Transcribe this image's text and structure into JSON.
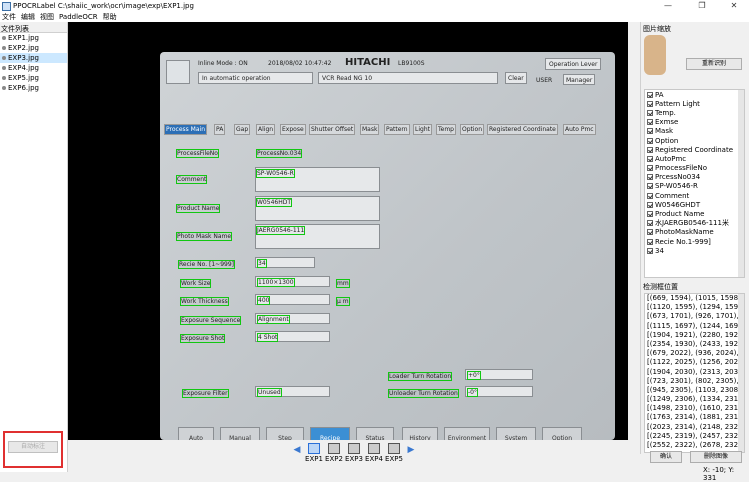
{
  "window": {
    "title": "PPOCRLabel C:\\shaiic_work\\ocr\\image\\exp\\EXP1.jpg",
    "min": "—",
    "max": "❐",
    "close": "✕"
  },
  "menu": [
    "文件",
    "编辑",
    "视图",
    "PaddleOCR",
    "帮助"
  ],
  "file_list": {
    "header": "文件列表",
    "items": [
      "EXP1.jpg",
      "EXP2.jpg",
      "EXP3.jpg",
      "EXP4.jpg",
      "EXP5.jpg",
      "EXP6.jpg"
    ],
    "selected": 2
  },
  "auto_label_button": "自动标注",
  "screen": {
    "inline_mode": "Inline Mode : ON",
    "datetime": "2018/08/02  10:47:42",
    "brand": "HITACHI",
    "model": "LB9100S",
    "auto_op": "In automatic operation",
    "vcr": "VCR Read NG 10",
    "operation_lever": "Operation Lever",
    "clear": "Clear",
    "user": "USER",
    "manager": "Manager",
    "tabs": [
      "Process Main",
      "PA",
      "Gap",
      "Align",
      "Expose",
      "Shutter Offset",
      "Mask",
      "Pattern",
      "Light",
      "Temp",
      "Option",
      "Registered Coordinate",
      "Auto Pmc"
    ],
    "fields": {
      "process_file_no_label": "ProcessFileNo",
      "process_file_no_value": "ProcessNo.034",
      "comment_label": "Comment",
      "comment_value": "SP-W0546-R",
      "product_name_label": "Product Name",
      "product_name_value": "W0546HDT",
      "photo_mask_label": "Photo Mask Name",
      "photo_mask_value": "JAERG0546-111",
      "recipe_no_label": "Recie No. [1~999]",
      "recipe_no_value": "34",
      "work_size_label": "Work Size",
      "work_size_value": "1100×1300  ",
      "work_size_unit": "mm",
      "work_thickness_label": "Work Thickness",
      "work_thickness_value": "400",
      "work_thickness_unit": "μ m",
      "exposure_sequence_label": "Exposure Sequence",
      "exposure_sequence_value": "Alignment",
      "exposure_shot_label": "Exposure Shot",
      "exposure_shot_value": "4 Shot",
      "exposure_filter_label": "Exposure Filter",
      "exposure_filter_value": "Unused",
      "loader_turn_label": "Loader Turn Rotation",
      "loader_turn_value": "+0°",
      "unloader_turn_label": "Unloader Turn Rotation",
      "unloader_turn_value": "-0°"
    },
    "bottom_buttons": [
      "Auto",
      "Manual",
      "Step",
      "Recipe",
      "Status",
      "History",
      "Environment",
      "System",
      "Option"
    ]
  },
  "right_panel": {
    "zoom_header": "图片缩放",
    "relabel": "重新识别",
    "labels": [
      "PA",
      "Pattern Light",
      "Temp.",
      "Exmse",
      "Mask",
      "Option",
      "Registered Coordinate",
      "AutoPmc",
      "PmocessFileNo",
      "PrcessNo034",
      "SP-W0546-R",
      "Comment",
      "W0546GHDT",
      "Product Name",
      "水JAERGB0546-111米",
      "PhotoMaskName",
      "Recie No.1-999]",
      "34"
    ],
    "box_header": "检测框位置",
    "boxes": [
      "[(669, 1594), (1015, 1598), (1",
      "[(1120, 1595), (1294, 1595), (",
      "[(673, 1701), (926, 1701), (92",
      "[(1115, 1697), (1244, 1699), (",
      "[(1904, 1921), (2280, 1929), (",
      "[(2354, 1930), (2433, 1927), (",
      "[(679, 2022), (936, 2024), (93",
      "[(1122, 2025), (1256, 2029), (",
      "[(1904, 2030), (2313, 2036), (",
      "[(723, 2301), (802, 2305), (80",
      "[(945, 2305), (1103, 2308), (1",
      "[(1249, 2306), (1334, 2312), (",
      "[(1498, 2310), (1610, 2319), (",
      "[(1763, 2314), (1881, 2319), (",
      "[(2023, 2314), (2148, 2321), (",
      "[(2245, 2319), (2457, 2323), (",
      "[(2552, 2322), (2678, 2327), ("
    ],
    "confirm": "确认",
    "delete": "删除图像"
  },
  "thumbnails": [
    "EXP1",
    "EXP2",
    "EXP3",
    "EXP4",
    "EXP5"
  ],
  "status": "X: -10; Y: 331"
}
